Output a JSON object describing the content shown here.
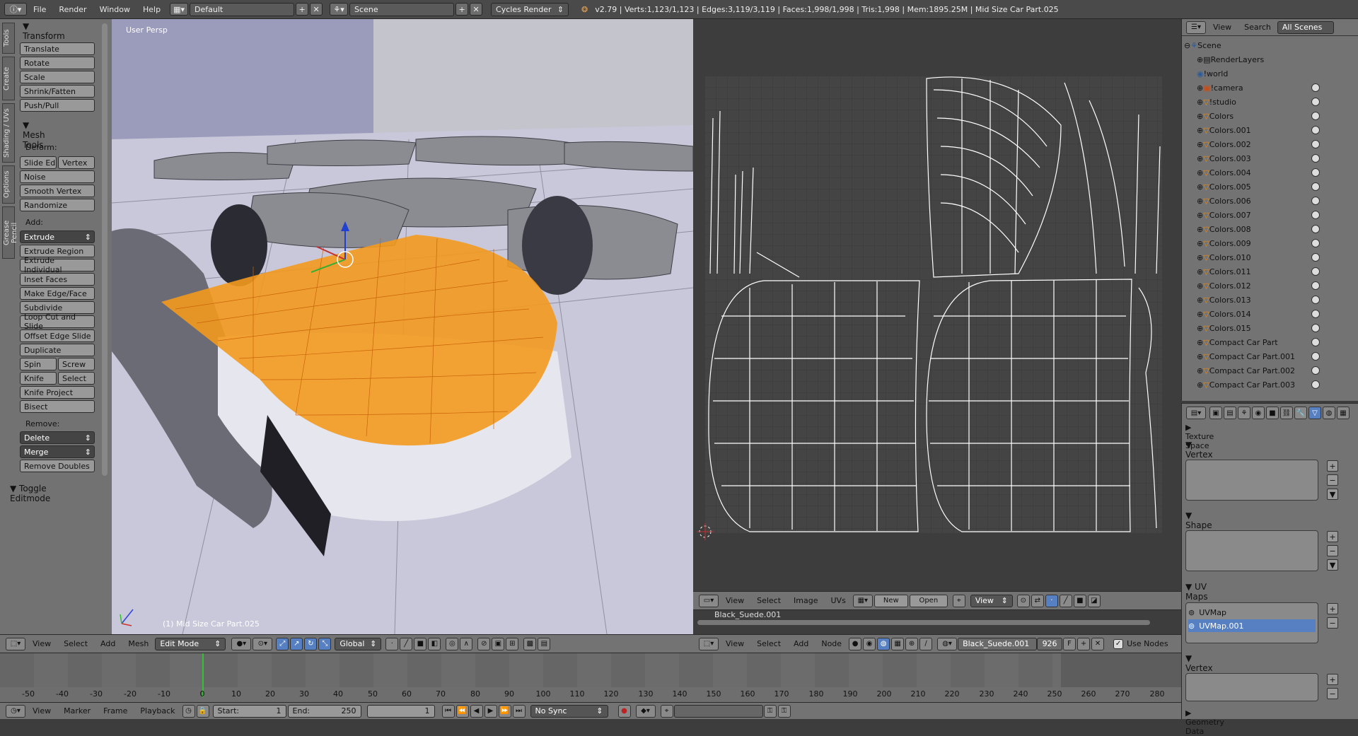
{
  "topbar": {
    "menus": [
      "File",
      "Render",
      "Window",
      "Help"
    ],
    "layout": "Default",
    "scene": "Scene",
    "engine": "Cycles Render",
    "status": "v2.79 | Verts:1,123/1,123 | Edges:3,119/3,119 | Faces:1,998/1,998 | Tris:1,998 | Mem:1895.25M | Mid Size Car Part.025"
  },
  "tool_tabs": [
    "Tools",
    "Create",
    "Shading / UVs",
    "Options",
    "Grease Pencil"
  ],
  "tools": {
    "transform_title": "Transform",
    "transform_buttons": [
      "Translate",
      "Rotate",
      "Scale",
      "Shrink/Fatten",
      "Push/Pull"
    ],
    "mesh_title": "Mesh Tools",
    "deform_label": "Deform:",
    "slide_edge": "Slide Ed",
    "vertex": "Vertex",
    "deform_buttons": [
      "Noise",
      "Smooth Vertex",
      "Randomize"
    ],
    "add_label": "Add:",
    "extrude": "Extrude",
    "add_buttons": [
      "Extrude Region",
      "Extrude Individual",
      "Inset Faces",
      "Make Edge/Face",
      "Subdivide",
      "Loop Cut and Slide",
      "Offset Edge Slide",
      "Duplicate"
    ],
    "spin": "Spin",
    "screw": "Screw",
    "knife": "Knife",
    "select": "Select",
    "knife_project": "Knife Project",
    "bisect": "Bisect",
    "remove_label": "Remove:",
    "delete": "Delete",
    "merge": "Merge",
    "remove_doubles": "Remove Doubles",
    "toggle_editmode": "Toggle Editmode"
  },
  "viewport": {
    "persp_label": "User Persp",
    "object_label": "(1) Mid Size Car Part.025",
    "header": {
      "menus": [
        "View",
        "Select",
        "Add",
        "Mesh"
      ],
      "mode": "Edit Mode",
      "orientation": "Global"
    }
  },
  "uv_editor": {
    "header_menus": [
      "View",
      "Select",
      "Image",
      "UVs"
    ],
    "new_label": "New",
    "open_label": "Open",
    "view_label": "View",
    "material_strip": "Black_Suede.001"
  },
  "node_editor": {
    "header_menus": [
      "View",
      "Select",
      "Add",
      "Node"
    ],
    "material": "Black_Suede.001",
    "users": "926",
    "fake_user": "F",
    "use_nodes": "Use Nodes"
  },
  "outliner": {
    "header_view": "View",
    "header_search": "Search",
    "header_scope": "All Scenes",
    "items": [
      "Scene",
      "RenderLayers",
      "!world",
      "!camera",
      "!studio",
      "Colors",
      "Colors.001",
      "Colors.002",
      "Colors.003",
      "Colors.004",
      "Colors.005",
      "Colors.006",
      "Colors.007",
      "Colors.008",
      "Colors.009",
      "Colors.010",
      "Colors.011",
      "Colors.012",
      "Colors.013",
      "Colors.014",
      "Colors.015",
      "Compact Car Part",
      "Compact Car Part.001",
      "Compact Car Part.002",
      "Compact Car Part.003"
    ]
  },
  "properties": {
    "texture_space": "Texture Space",
    "vertex_groups": "Vertex Groups",
    "shape_keys": "Shape Keys",
    "uv_maps": "UV Maps",
    "uv_map_items": [
      "UVMap",
      "UVMap.001"
    ],
    "vertex_colors": "Vertex Colors",
    "geometry_data": "Geometry Data"
  },
  "timeline": {
    "ticks": [
      "-50",
      "-40",
      "-30",
      "-20",
      "-10",
      "0",
      "10",
      "20",
      "30",
      "40",
      "50",
      "60",
      "70",
      "80",
      "90",
      "100",
      "110",
      "120",
      "130",
      "140",
      "150",
      "160",
      "170",
      "180",
      "190",
      "200",
      "210",
      "220",
      "230",
      "240",
      "250",
      "260",
      "270",
      "280"
    ],
    "header_menus": [
      "View",
      "Marker",
      "Frame",
      "Playback"
    ],
    "start_label": "Start:",
    "start_value": "1",
    "end_label": "End:",
    "end_value": "250",
    "current_frame": "1",
    "sync": "No Sync"
  },
  "colors": {
    "selection_orange": "#f39a1e",
    "uv_highlight": "#5680c2"
  }
}
